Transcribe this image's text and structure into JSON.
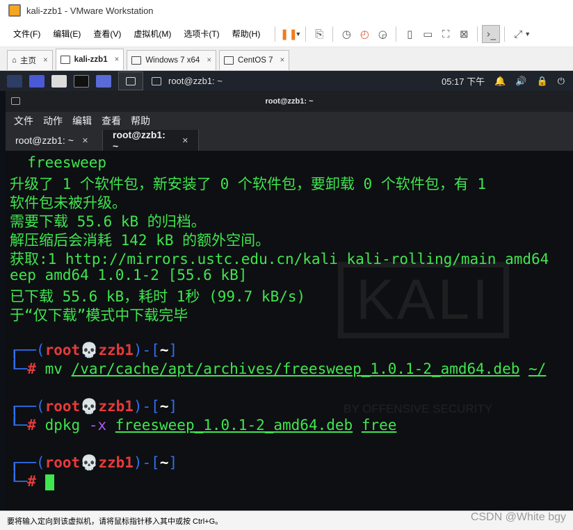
{
  "window": {
    "title": "kali-zzb1 - VMware Workstation"
  },
  "menubar": {
    "items": [
      "文件(F)",
      "编辑(E)",
      "查看(V)",
      "虚拟机(M)",
      "选项卡(T)",
      "帮助(H)"
    ]
  },
  "toolbar": {
    "icons": [
      "pause-icon",
      "send-keys-icon",
      "snapshot-icon",
      "revert-snapshot-icon",
      "snapshot-manager-icon",
      "sidebar-icon",
      "thumbnail-icon",
      "fullscreen-icon",
      "unity-icon",
      "console-icon",
      "stretch-icon"
    ]
  },
  "vm_tabs": [
    {
      "label": "主页",
      "active": false
    },
    {
      "label": "kali-zzb1",
      "active": true
    },
    {
      "label": "Windows 7 x64",
      "active": false
    },
    {
      "label": "CentOS 7",
      "active": false
    }
  ],
  "kali_panel": {
    "window_title": "root@zzb1: ~",
    "clock": "05:17 下午"
  },
  "terminal": {
    "title": "root@zzb1: ~",
    "menu": [
      "文件",
      "动作",
      "编辑",
      "查看",
      "帮助"
    ],
    "tabs": [
      {
        "label": "root@zzb1: ~",
        "active": false
      },
      {
        "label": "root@zzb1: ~",
        "active": true
      }
    ],
    "output": [
      "  freesweep",
      "升级了 1 个软件包，新安装了 0 个软件包，要卸载 0 个软件包，有 1",
      "软件包未被升级。",
      "需要下载 55.6 kB 的归档。",
      "解压缩后会消耗 142 kB 的额外空间。",
      "获取:1 http://mirrors.ustc.edu.cn/kali kali-rolling/main amd64",
      "eep amd64 1.0.1-2 [55.6 kB]",
      "已下载 55.6 kB，耗时 1秒 (99.7 kB/s)",
      "于“仅下载”模式中下载完毕"
    ],
    "prompt": {
      "user": "root",
      "skull": "💀",
      "host": "zzb1",
      "dir": "~"
    },
    "commands": [
      {
        "exe": "mv",
        "opt": "",
        "args": [
          "/var/cache/apt/archives/freesweep_1.0.1-2_amd64.deb",
          "~/"
        ]
      },
      {
        "exe": "dpkg",
        "opt": "-x",
        "args": [
          "freesweep_1.0.1-2_amd64.deb",
          "free"
        ]
      }
    ],
    "watermark": {
      "logo": "KALI",
      "tagline": "BY OFFENSIVE SECURITY"
    }
  },
  "statusbar": {
    "text": "要将输入定向到该虚拟机，请将鼠标指针移入其中或按 Ctrl+G。",
    "watermark": "CSDN @White bgy"
  },
  "colors": {
    "prompt_bracket": "#2f6ff0",
    "prompt_user": "#e53b3b",
    "output_green": "#3fe64f",
    "option_purple": "#b058ff",
    "pause_orange": "#f07b1d"
  }
}
